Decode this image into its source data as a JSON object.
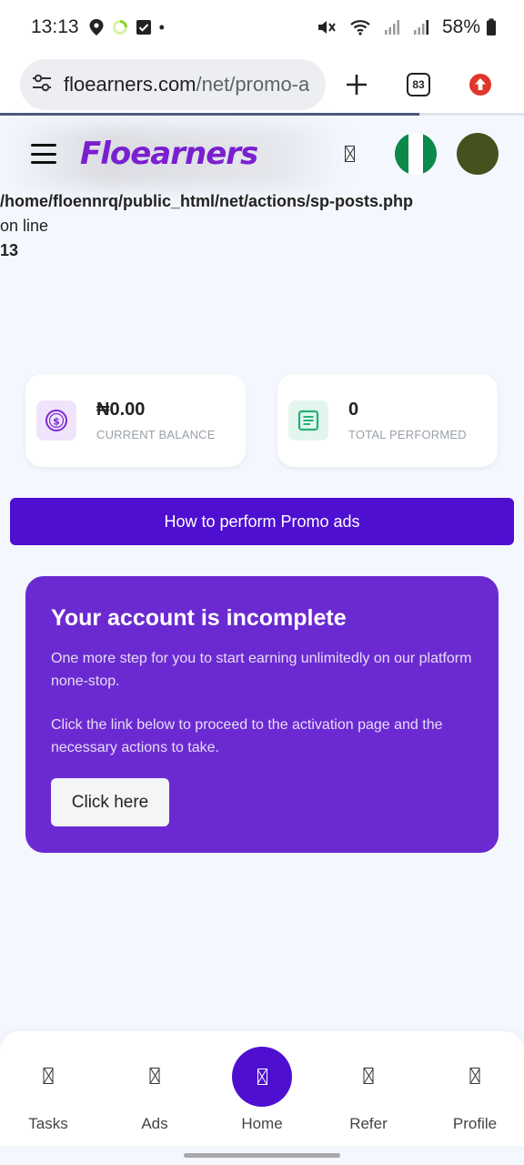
{
  "status_bar": {
    "time": "13:13",
    "battery": "58%",
    "dot": "•"
  },
  "browser": {
    "url_host": "floearners.com",
    "url_path": "/net/promo-a",
    "tab_count": "83"
  },
  "site": {
    "logo_text": "Floearners",
    "flag_colors": [
      "#0a8a4a",
      "#ffffff",
      "#0a8a4a"
    ],
    "avatar_color": "#44521e"
  },
  "error": {
    "line1": "/home/floennrq/public_html/net/actions/sp-posts.php",
    "line2": "on line",
    "line3": "13"
  },
  "stats": [
    {
      "value": "₦0.00",
      "label": "CURRENT BALANCE",
      "icon": "dollar-coin-icon",
      "color": "#7a2ad0",
      "bg": "#efe4fb"
    },
    {
      "value": "0",
      "label": "TOTAL PERFORMED",
      "icon": "document-icon",
      "color": "#26b07a",
      "bg": "#e2f6ee"
    }
  ],
  "how_button": "How to perform Promo ads",
  "incomplete": {
    "title": "Your account is incomplete",
    "p1": "One more step for you to start earning unlimitedly on our platform none-stop.",
    "p2": "Click the link below to proceed to the activation page and the necessary actions to take.",
    "button": "Click here"
  },
  "nav": [
    {
      "label": "Tasks"
    },
    {
      "label": "Ads"
    },
    {
      "label": "Home"
    },
    {
      "label": "Refer"
    },
    {
      "label": "Profile"
    }
  ],
  "colors": {
    "primary": "#4e0fd0",
    "card_purple": "#6b2ad1",
    "background": "#f4f7fe"
  }
}
